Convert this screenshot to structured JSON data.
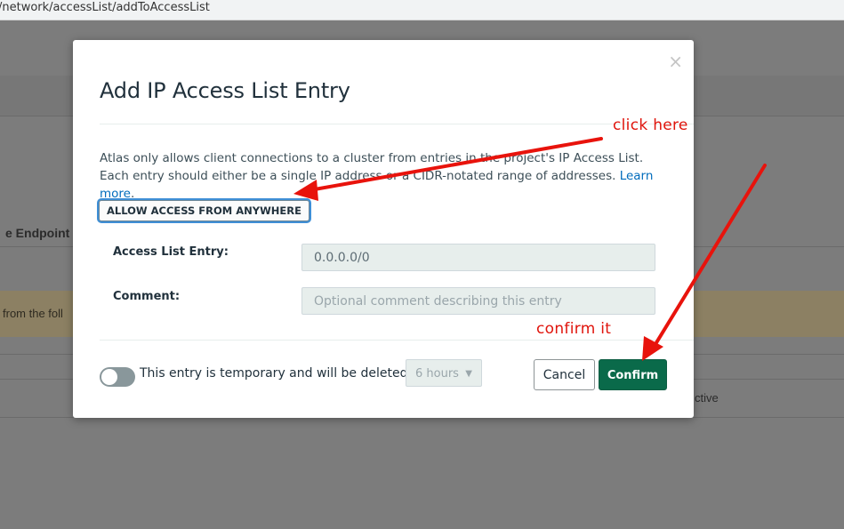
{
  "browser": {
    "url_fragment": "/network/accessList/addToAccessList"
  },
  "background": {
    "endpoint_header": "e Endpoint",
    "warning_text": "from the foll",
    "status_text": "ctive"
  },
  "modal": {
    "close_glyph": "×",
    "title": "Add IP Access List Entry",
    "description": "Atlas only allows client connections to a cluster from entries in the project's IP Access List. Each entry should either be a single IP address or a CIDR-notated range of addresses.",
    "learn_more": "Learn more",
    "allow_anywhere_label": "ALLOW ACCESS FROM ANYWHERE",
    "access_list_label": "Access List Entry:",
    "access_list_value": "0.0.0.0/0",
    "comment_label": "Comment:",
    "comment_placeholder": "Optional comment describing this entry",
    "temporary_text": "This entry is temporary and will be deleted in",
    "duration_value": "6 hours",
    "temporary_enabled": false,
    "cancel_label": "Cancel",
    "confirm_label": "Confirm"
  },
  "annotations": {
    "click_here": "click here",
    "confirm_it": "confirm it",
    "color": "#e0140c"
  },
  "colors": {
    "confirm_bg": "#0a6a4a",
    "link": "#006cbc",
    "overlay": "#7c7c7c"
  }
}
